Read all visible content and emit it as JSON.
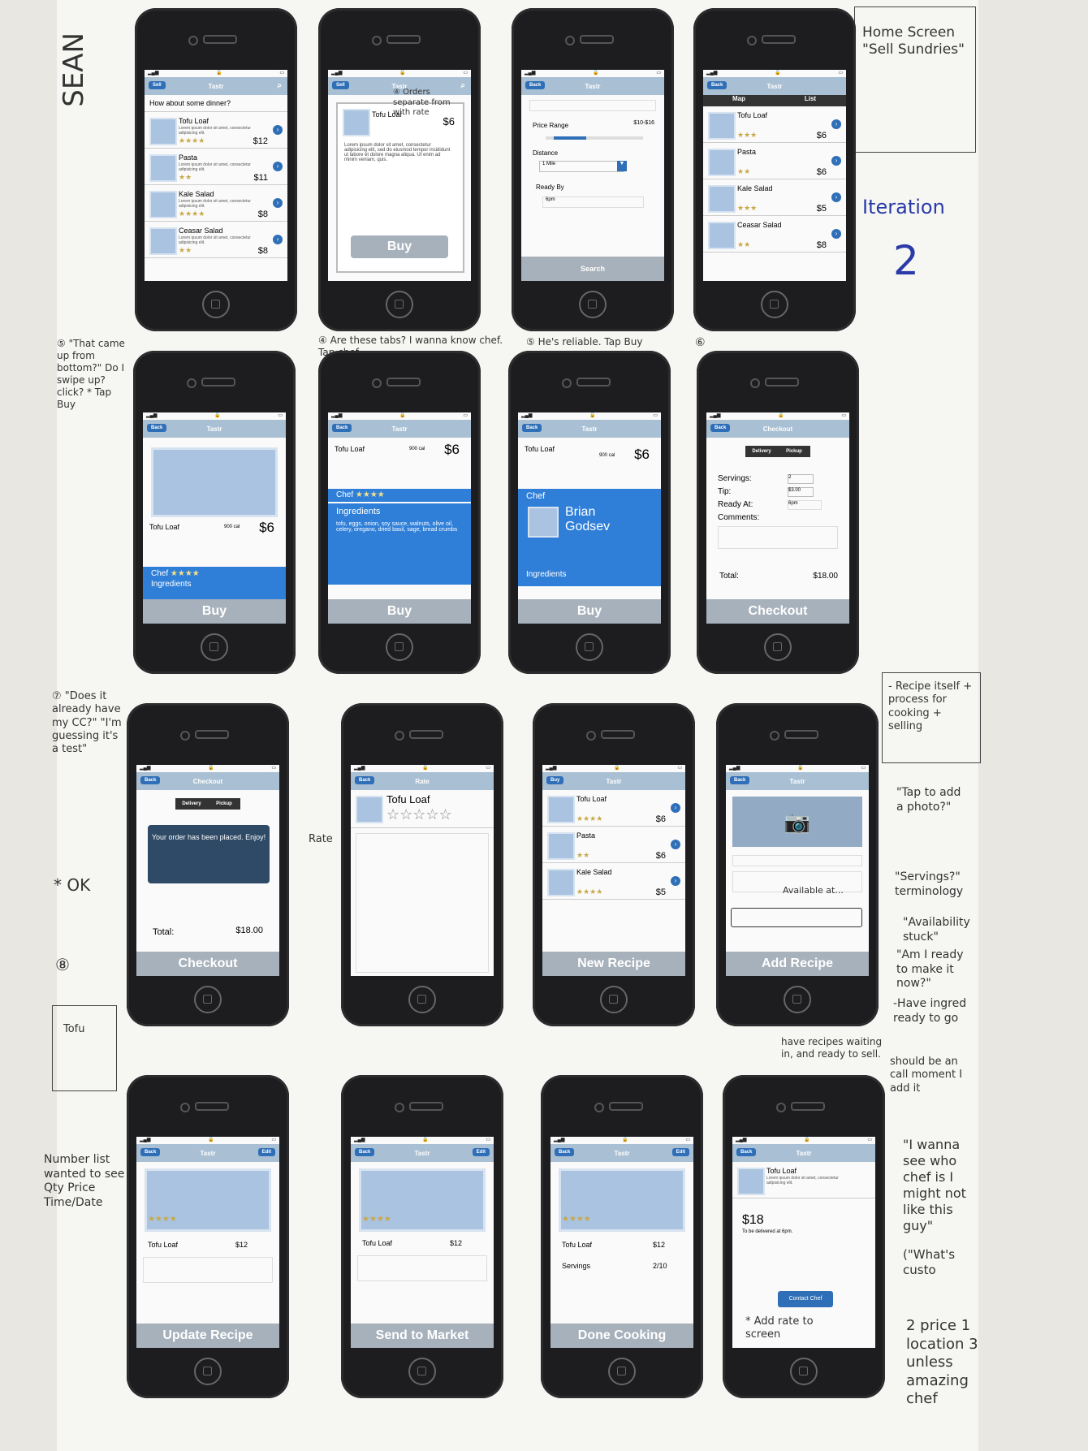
{
  "notes": {
    "sean": "SEAN",
    "home_screen": "Home Screen \"Sell Sundries\"",
    "iteration": "Iteration",
    "iteration_num": "2",
    "n5_left": "⑤ \"That came up from bottom?\" Do I swipe up? click? * Tap Buy",
    "n4": "④ Are these tabs? I wanna know chef. Tap chef",
    "n5": "⑤ He's reliable. Tap Buy",
    "n6": "⑥",
    "n7": "⑦ \"Does it already have my CC?\" \"I'm guessing it's a test\"",
    "ok": "* OK",
    "n8": "⑧",
    "rate": "Rate",
    "recipe_itself": "- Recipe itself + process for cooking + selling",
    "tap_photo": "\"Tap to add a photo?\"",
    "servings_term": "\"Servings?\" terminology",
    "availability": "\"Availability stuck\"",
    "am_i_ready": "\"Am I ready to make it now?\"",
    "ingred_ready": "-Have ingred ready to go",
    "available_at": "Available at...",
    "recipes_waiting": "have recipes waiting in, and ready to sell.",
    "call_moment": "should be an call moment I add it",
    "number_list": "Number list wanted to see Qty Price Time/Date",
    "tofu": "Tofu",
    "see_chef": "\"I wanna see who chef is I might not like this guy\"",
    "whats_cust": "(\"What's custo",
    "add_rate": "* Add rate to screen",
    "priority": "2 price 1 location 3 unless amazing chef"
  },
  "screens": {
    "home": {
      "title": "Tastr",
      "left_btn": "Sell",
      "prompt": "How about some dinner?",
      "items": [
        {
          "name": "Tofu Loaf",
          "price": "$12",
          "stars": "★★★★"
        },
        {
          "name": "Pasta",
          "price": "$11",
          "stars": "★★"
        },
        {
          "name": "Kale Salad",
          "price": "$8",
          "stars": "★★★★"
        },
        {
          "name": "Ceasar Salad",
          "price": "$8",
          "stars": "★★"
        }
      ],
      "lorem": "Lorem ipsum dolor sit amet, consectetur adipisicing elit."
    },
    "popup": {
      "title": "Tastr",
      "left_btn": "Sell",
      "name": "Tofu Loaf",
      "price": "$6",
      "buy": "Buy",
      "note": "④ Orders separate from with rate",
      "lorem": "Lorem ipsum dolor sit amet, consectetur adipisicing elit, sed do eiusmod tempor incididunt ut labore et dolore magna aliqua. Ut enim ad minim veniam, quis."
    },
    "search": {
      "title": "Tastr",
      "left_btn": "Back",
      "price_range": "Price Range",
      "price_val": "$10-$16",
      "distance": "Distance",
      "distance_val": "1 Mile",
      "ready_by": "Ready By",
      "ready_val": "6pm",
      "search": "Search"
    },
    "map_list": {
      "title": "Tastr",
      "left_btn": "Back",
      "tab_map": "Map",
      "tab_list": "List",
      "items": [
        {
          "name": "Tofu Loaf",
          "price": "$6",
          "stars": "★★★"
        },
        {
          "name": "Pasta",
          "price": "$6",
          "stars": "★★"
        },
        {
          "name": "Kale Salad",
          "price": "$5",
          "stars": "★★★"
        },
        {
          "name": "Ceasar Salad",
          "price": "$8",
          "stars": "★★"
        }
      ]
    },
    "detail1": {
      "title": "Tastr",
      "left_btn": "Back",
      "name": "Tofu Loaf",
      "cal": "900 cal",
      "price": "$6",
      "chef": "Chef",
      "ingredients": "Ingredients",
      "buy": "Buy",
      "stars": "★★★★"
    },
    "detail2": {
      "title": "Tastr",
      "left_btn": "Back",
      "name": "Tofu Loaf",
      "cal": "900 cal",
      "price": "$6",
      "chef": "Chef",
      "stars": "★★★★",
      "ingredients": "Ingredients",
      "ingredients_list": "tofu, eggs, onion, soy sauce, walnuts, olive oil, celery, oregano, dried basil, sage, bread crumbs",
      "buy": "Buy"
    },
    "detail3": {
      "title": "Tastr",
      "left_btn": "Back",
      "name": "Tofu Loaf",
      "cal": "900 cal",
      "price": "$6",
      "chef": "Chef",
      "chef_name": "Brian Godsev",
      "ingredients": "Ingredients",
      "buy": "Buy"
    },
    "checkout": {
      "title": "Checkout",
      "left_btn": "Back",
      "delivery": "Delivery",
      "pickup": "Pickup",
      "servings": "Servings:",
      "servings_val": "2",
      "tip": "Tip:",
      "tip_val": "$3.00",
      "ready_at": "Ready At:",
      "ready_val": "6pm",
      "comments": "Comments:",
      "total": "Total:",
      "total_val": "$18.00",
      "checkout": "Checkout"
    },
    "placed": {
      "title": "Checkout",
      "left_btn": "Back",
      "delivery": "Delivery",
      "pickup": "Pickup",
      "message": "Your order has been placed. Enjoy!",
      "total": "Total:",
      "total_val": "$18.00",
      "checkout": "Checkout"
    },
    "rate": {
      "title": "Rate",
      "left_btn": "Back",
      "name": "Tofu Loaf",
      "stars": "☆☆☆☆☆"
    },
    "sell_list": {
      "title": "Tastr",
      "left_btn": "Buy",
      "new_recipe": "New Recipe",
      "items": [
        {
          "name": "Tofu Loaf",
          "price": "$6",
          "stars": "★★★★"
        },
        {
          "name": "Pasta",
          "price": "$6",
          "stars": "★★"
        },
        {
          "name": "Kale Salad",
          "price": "$5",
          "stars": "★★★★"
        }
      ]
    },
    "add_recipe": {
      "title": "Tastr",
      "left_btn": "Back",
      "add_recipe": "Add Recipe"
    },
    "update": {
      "title": "Tastr",
      "left_btn": "Back",
      "right_btn": "Edit",
      "name": "Tofu Loaf",
      "price": "$12",
      "stars": "★★★★",
      "button": "Update Recipe"
    },
    "market": {
      "title": "Tastr",
      "left_btn": "Back",
      "right_btn": "Edit",
      "name": "Tofu Loaf",
      "price": "$12",
      "stars": "★★★★",
      "button": "Send to Market"
    },
    "cooking": {
      "title": "Tastr",
      "left_btn": "Back",
      "right_btn": "Edit",
      "name": "Tofu Loaf",
      "price": "$12",
      "servings": "Servings",
      "servings_val": "2/10",
      "stars": "★★★★",
      "button": "Done Cooking"
    },
    "contact": {
      "title": "Tastr",
      "left_btn": "Back",
      "name": "Tofu Loaf",
      "price": "$18",
      "delivery": "To be delivered at 6pm.",
      "button": "Contact Chef"
    }
  }
}
